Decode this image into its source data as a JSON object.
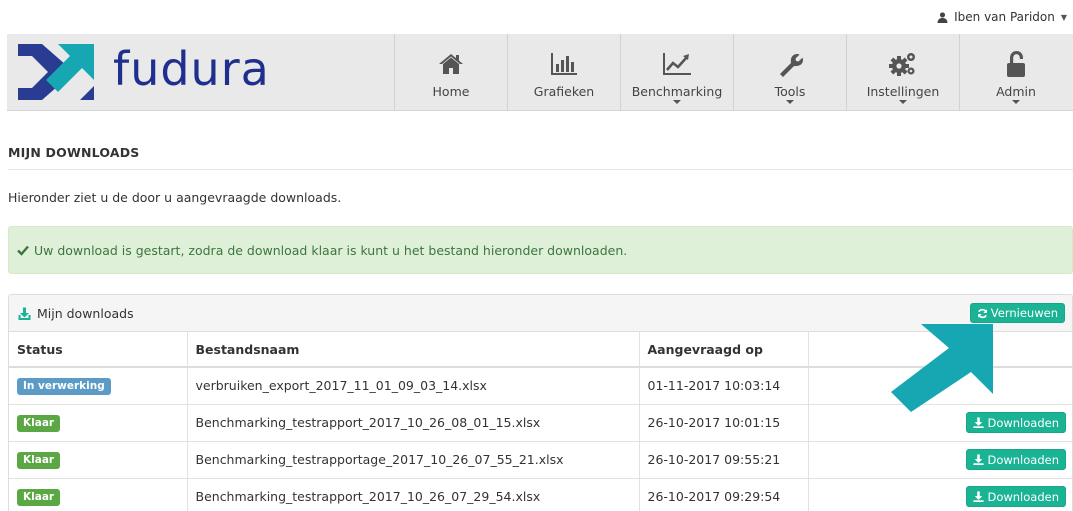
{
  "user": {
    "name": "Iben van Paridon",
    "icon": "user-icon"
  },
  "brand": {
    "name": "fudura",
    "logo_colors": [
      "#2a3c92",
      "#16a7b2"
    ]
  },
  "nav": {
    "items": [
      {
        "label": "Home",
        "icon": "home-icon",
        "has_dropdown": false
      },
      {
        "label": "Grafieken",
        "icon": "bar-chart-icon",
        "has_dropdown": false
      },
      {
        "label": "Benchmarking",
        "icon": "line-chart-icon",
        "has_dropdown": true
      },
      {
        "label": "Tools",
        "icon": "wrench-icon",
        "has_dropdown": true
      },
      {
        "label": "Instellingen",
        "icon": "gears-icon",
        "has_dropdown": true
      },
      {
        "label": "Admin",
        "icon": "unlock-icon",
        "has_dropdown": true
      }
    ]
  },
  "page": {
    "title": "MIJN DOWNLOADS",
    "intro": "Hieronder ziet u de door u aangevraagde downloads."
  },
  "alert": {
    "text": "Uw download is gestart, zodra de download klaar is kunt u het bestand hieronder downloaden.",
    "color": "#dff0d8",
    "icon": "check-icon"
  },
  "panel": {
    "title": "Mijn downloads",
    "refresh_label": "Vernieuwen",
    "columns": [
      "Status",
      "Bestandsnaam",
      "Aangevraagd op",
      ""
    ],
    "rows": [
      {
        "status": "In verwerking",
        "status_type": "processing",
        "file": "verbruiken_export_2017_11_01_09_03_14.xlsx",
        "date": "01-11-2017 10:03:14",
        "action": ""
      },
      {
        "status": "Klaar",
        "status_type": "done",
        "file": "Benchmarking_testrapport_2017_10_26_08_01_15.xlsx",
        "date": "26-10-2017 10:01:15",
        "action": "Downloaden"
      },
      {
        "status": "Klaar",
        "status_type": "done",
        "file": "Benchmarking_testrapportage_2017_10_26_07_55_21.xlsx",
        "date": "26-10-2017 09:55:21",
        "action": "Downloaden"
      },
      {
        "status": "Klaar",
        "status_type": "done",
        "file": "Benchmarking_testrapport_2017_10_26_07_29_54.xlsx",
        "date": "26-10-2017 09:29:54",
        "action": "Downloaden"
      }
    ]
  },
  "colors": {
    "accent": "#1ab394",
    "badge_processing": "#5b9bc5",
    "badge_done": "#5ba744",
    "annotation_arrow": "#16a7b2"
  }
}
